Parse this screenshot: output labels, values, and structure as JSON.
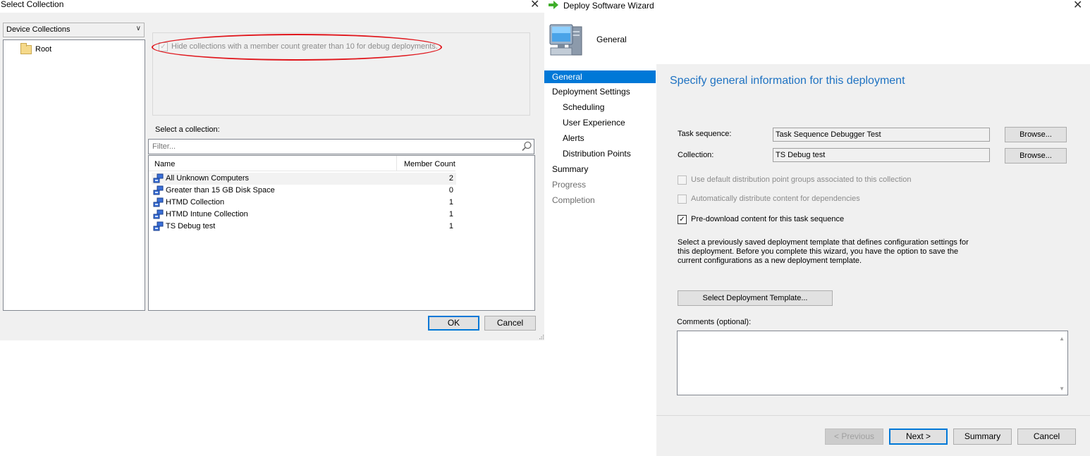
{
  "select_collection": {
    "title": "Select Collection",
    "close_glyph": "✕",
    "collection_type": "Device Collections",
    "tree_root": "Root",
    "hide_checkbox_label": "Hide collections with a member count greater than 10 for debug deployments.",
    "hide_checkbox_checked": true,
    "select_label": "Select a collection:",
    "filter_placeholder": "Filter...",
    "columns": {
      "name": "Name",
      "member_count": "Member Count"
    },
    "rows": [
      {
        "name": "All Unknown Computers",
        "count": "2"
      },
      {
        "name": "Greater than 15 GB Disk Space",
        "count": "0"
      },
      {
        "name": "HTMD Collection",
        "count": "1"
      },
      {
        "name": "HTMD Intune Collection",
        "count": "1"
      },
      {
        "name": "TS Debug test",
        "count": "1"
      }
    ],
    "ok_label": "OK",
    "cancel_label": "Cancel",
    "highlight_color": "#e0161c"
  },
  "wizard": {
    "title": "Deploy Software Wizard",
    "close_glyph": "✕",
    "header": "General",
    "nav": {
      "general": "General",
      "deployment_settings": "Deployment Settings",
      "scheduling": "Scheduling",
      "user_experience": "User Experience",
      "alerts": "Alerts",
      "distribution_points": "Distribution Points",
      "summary": "Summary",
      "progress": "Progress",
      "completion": "Completion"
    },
    "page_title": "Specify general information for this deployment",
    "task_sequence_label": "Task sequence:",
    "task_sequence_value": "Task Sequence Debugger Test",
    "collection_label": "Collection:",
    "collection_value": "TS Debug test",
    "browse_label": "Browse...",
    "use_default_dp_label": "Use default distribution point groups associated to this collection",
    "auto_distribute_label": "Automatically distribute content for dependencies",
    "predownload_label": "Pre-download content for this task sequence",
    "predownload_checked": true,
    "description": "Select a previously saved deployment template that defines configuration settings for this deployment. Before you complete this wizard, you have the option to save the current configurations as a new deployment template.",
    "template_button": "Select Deployment Template...",
    "comments_label": "Comments (optional):",
    "comments_value": "",
    "buttons": {
      "previous": "< Previous",
      "next": "Next >",
      "summary": "Summary",
      "cancel": "Cancel"
    },
    "accent_color": "#0078d7",
    "title_color": "#1e72c2"
  }
}
